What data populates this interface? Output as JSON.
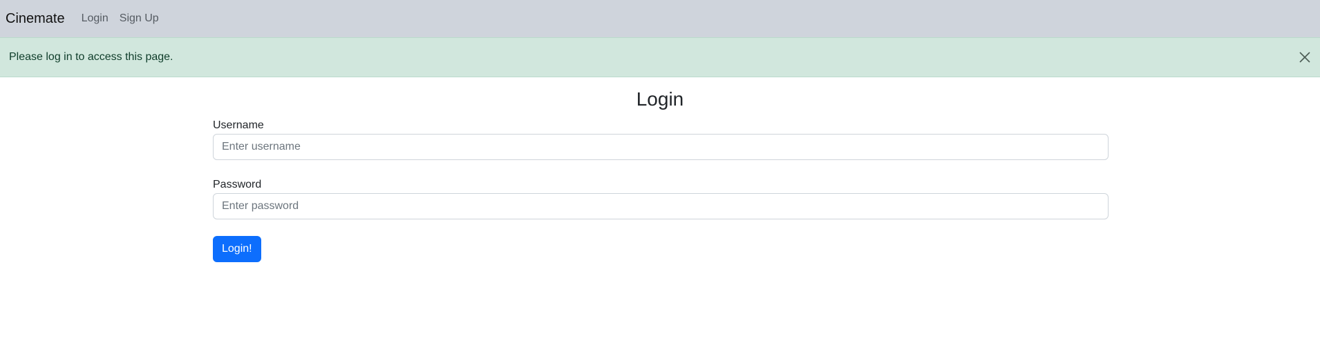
{
  "navbar": {
    "brand": "Cinemate",
    "links": [
      {
        "label": "Login"
      },
      {
        "label": "Sign Up"
      }
    ]
  },
  "alert": {
    "message": "Please log in to access this page.",
    "close_icon": "close-icon",
    "background_color": "#d1e7dd"
  },
  "page": {
    "title": "Login"
  },
  "form": {
    "username": {
      "label": "Username",
      "placeholder": "Enter username",
      "value": ""
    },
    "password": {
      "label": "Password",
      "placeholder": "Enter password",
      "value": ""
    },
    "submit_label": "Login!"
  },
  "colors": {
    "navbar_bg": "#cfd4dc",
    "primary": "#0d6efd"
  }
}
